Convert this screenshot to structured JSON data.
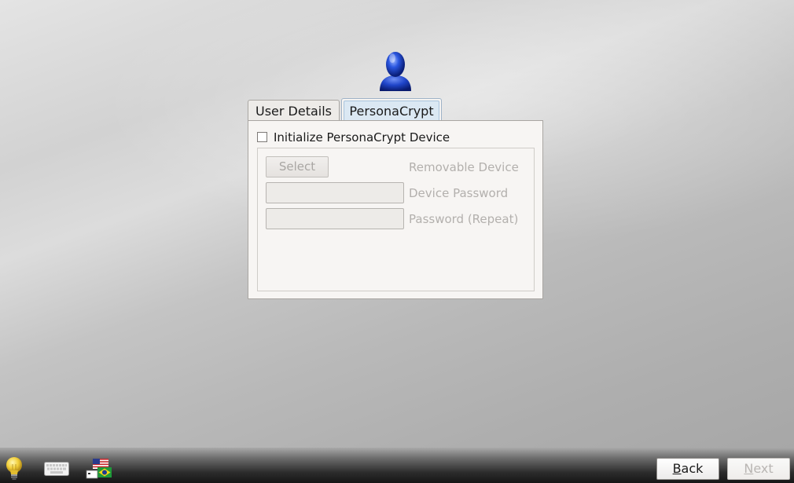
{
  "tabs": [
    {
      "label": "User Details",
      "active": false
    },
    {
      "label": "PersonaCrypt",
      "active": true
    }
  ],
  "personacrypt": {
    "init_checkbox_label": "Initialize PersonaCrypt Device",
    "init_checked": false,
    "select_button_label": "Select",
    "removable_device_label": "Removable Device",
    "device_password_label": "Device Password",
    "device_password_value": "",
    "password_repeat_label": "Password (Repeat)",
    "password_repeat_value": ""
  },
  "bottom_bar": {
    "icons": [
      "lightbulb-icon",
      "keyboard-icon",
      "locale-flag-icon"
    ],
    "back_button": {
      "mnemonic": "B",
      "rest": "ack"
    },
    "next_button": {
      "mnemonic": "N",
      "rest": "ext",
      "enabled": false
    }
  },
  "colors": {
    "accent_tab": "#dbe8f3",
    "avatar_blue": "#1c3fb5"
  }
}
